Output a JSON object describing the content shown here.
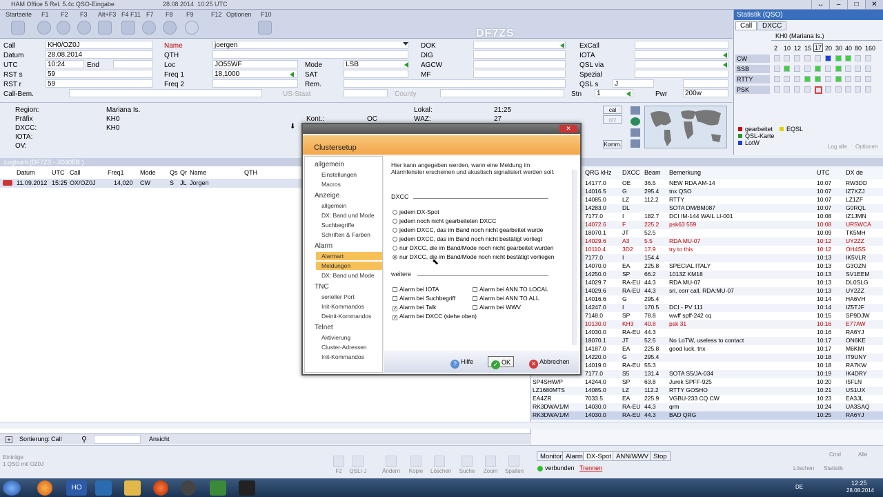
{
  "window": {
    "title_items": [
      "Startseite",
      "F1",
      "F2",
      "F3",
      "Alt+F3",
      "F4 F11",
      "F7",
      "F8",
      "F9",
      "F12",
      "Optionen",
      "F10"
    ],
    "title": "HAM Office 5  Rel. 5.4c   QSO-Eingabe",
    "date": "28.08.2014",
    "time": "10:25 UTC",
    "callsign_display": "DF7ZS"
  },
  "form": {
    "call_label": "Call",
    "call_value": "KH0/OZ0J",
    "date_label": "Datum",
    "date_value": "28.08.2014",
    "utc_label": "UTC",
    "utc_value": "10:24",
    "end_label": "End",
    "rsts_label": "RST s",
    "rsts_value": "59",
    "rstr_label": "RST r",
    "rstr_value": "59",
    "callbem_label": "Call-Bem.",
    "name_label": "Name",
    "name_value": "joergen",
    "qth_label": "QTH",
    "loc_label": "Loc",
    "loc_value": "JO55WF",
    "freq1_label": "Freq 1",
    "freq1_value": "18,1000",
    "freq2_label": "Freq 2",
    "mode_label": "Mode",
    "mode_value": "LSB",
    "sat_label": "SAT",
    "rem_label": "Rem.",
    "usstaat_label": "US-Staat",
    "county_label": "County",
    "dok_label": "DOK",
    "dig_label": "DIG",
    "agcw_label": "AGCW",
    "mf_label": "MF",
    "excall_label": "ExCall",
    "iota_label": "IOTA",
    "qslvia_label": "QSL via",
    "spezial_label": "Spezial",
    "qsls_label": "QSL s",
    "qsls_value": "J",
    "stn_label": "Stn",
    "stn_value": "1",
    "pwr_label": "Pwr",
    "pwr_value": "200w"
  },
  "stats": {
    "header": "Statistik (QSO)",
    "tabs": [
      "Call",
      "DXCC"
    ],
    "entity": "KH0 (Mariana Is.)",
    "bands": [
      "2",
      "10",
      "12",
      "15",
      "17",
      "20",
      "30",
      "40",
      "80",
      "160"
    ],
    "modes": [
      "CW",
      "SSB",
      "RTTY",
      "PSK"
    ],
    "legend": [
      "gearbeitet",
      "EQSL",
      "QSL-Karte",
      "LotW"
    ],
    "actions": [
      "Log alle",
      "Optionen"
    ]
  },
  "info": {
    "region_label": "Region:",
    "region_value": "Mariana Is.",
    "prefix_label": "Präfix",
    "prefix_value": "KH0",
    "dxcc_label": "DXCC:",
    "dxcc_value": "KH0",
    "iota_label": "IOTA:",
    "ov_label": "OV:",
    "kont_label": "Kont.:",
    "kont_value": "OC",
    "lokal_label": "Lokal:",
    "lokal_value": "21:25",
    "waz_label": "WAZ:",
    "waz_value": "27",
    "side_buttons": [
      "cal",
      "qrz",
      "Komm."
    ]
  },
  "logbook": {
    "header": "Logbuch  (DF7ZS - JO40EB )",
    "columns": [
      "Datum",
      "UTC",
      "Call",
      "Freq1",
      "Mode",
      "Qs",
      "Qr",
      "Name",
      "QTH"
    ],
    "row": [
      "11.09.2012",
      "15:25",
      "OX/OZ0J",
      "14,020",
      "CW",
      "S",
      "JL",
      "Jorgen"
    ]
  },
  "dx": {
    "columns": [
      "QRG kHz",
      "DXCC",
      "Beam",
      "Bemerkung",
      "UTC",
      "DX de"
    ],
    "rows": [
      [
        "",
        "14177.0",
        "OE",
        "36.5",
        "NEW RDA AM-14",
        "10:07",
        "RW3DD",
        false
      ],
      [
        "",
        "14016.5",
        "G",
        "295.4",
        "tnx QSO",
        "10:07",
        "IZ7XZJ",
        false
      ],
      [
        "",
        "14085.0",
        "LZ",
        "112.2",
        "RTTY",
        "10:07",
        "LZ1ZF",
        false
      ],
      [
        "",
        "14283.0",
        "DL",
        "",
        "SOTA DM/BM087",
        "10:07",
        "G0RQL",
        false
      ],
      [
        "",
        "7177.0",
        "I",
        "182.7",
        "DCI IM-144 WAIL LI-001",
        "10:08",
        "IZ1JMN",
        false
      ],
      [
        "",
        "14072.6",
        "F",
        "225.2",
        "psk63 559",
        "10:08",
        "UR5WCA",
        true
      ],
      [
        "",
        "18070.1",
        "JT",
        "52.5",
        "",
        "10:09",
        "TK5MH",
        false
      ],
      [
        "",
        "14029.6",
        "A3",
        "5.5",
        "RDA MU-07",
        "10:12",
        "UY2ZZ",
        true
      ],
      [
        "",
        "10110.4",
        "3D2",
        "17.9",
        "try to this",
        "10:12",
        "OH4SS",
        true
      ],
      [
        "",
        "7177.0",
        "I",
        "154.4",
        "",
        "10:13",
        "IK5VLR",
        false
      ],
      [
        "",
        "14070.0",
        "EA",
        "225.8",
        "SPECIAL ITALY",
        "10:13",
        "G3OZN",
        false
      ],
      [
        "",
        "14250.0",
        "SP",
        "66.2",
        "1013Z KM18",
        "10:13",
        "SV1EEM",
        false
      ],
      [
        "",
        "14029.7",
        "RA-EU",
        "44.3",
        "RDA MU-07",
        "10:13",
        "DL0SLG",
        false
      ],
      [
        "",
        "14029.6",
        "RA-EU",
        "44.3",
        "sri, corr call, RDA:MU-07",
        "10:13",
        "UY2ZZ",
        false
      ],
      [
        "",
        "14016.6",
        "G",
        "295.4",
        "",
        "10:14",
        "HA6VH",
        false
      ],
      [
        "",
        "14247.0",
        "I",
        "170.5",
        "DCI - PV 111",
        "10:14",
        "IZ5TJF",
        false
      ],
      [
        "",
        "7148.0",
        "SP",
        "78.8",
        "wwff spff-242 cq",
        "10:15",
        "SP9DJW",
        false
      ],
      [
        "",
        "10130.0",
        "KH3",
        "40.8",
        "psk 31",
        "10:16",
        "E77AW",
        true
      ],
      [
        "",
        "14030.0",
        "RA-EU",
        "44.3",
        "",
        "10:16",
        "RA6YJ",
        false
      ],
      [
        "",
        "18070.1",
        "JT",
        "52.5",
        "No LoTW, useless to contact",
        "10:17",
        "ON6KE",
        false
      ],
      [
        "",
        "14187.0",
        "EA",
        "225.8",
        "good luck. tnx",
        "10:17",
        "M6KMI",
        false
      ],
      [
        "",
        "14220.0",
        "G",
        "295.4",
        "",
        "10:18",
        "IT9UNY",
        false
      ],
      [
        "",
        "14019.0",
        "RA-EU",
        "55.3",
        "",
        "10:18",
        "RA7KW",
        false
      ],
      [
        "",
        "7177.0",
        "S5",
        "131.4",
        "SOTA S5/JA-034",
        "10:19",
        "IK4DRY",
        false
      ],
      [
        "SP4SHW/P",
        "14244.0",
        "SP",
        "63.8",
        "Jurek SPFF-925",
        "10:20",
        "I5FLN",
        false
      ],
      [
        "LZ1680MTS",
        "14085.0",
        "LZ",
        "112.2",
        "RTTY GOSHO",
        "10:21",
        "US1UX",
        false
      ],
      [
        "EA4ZR",
        "7033.5",
        "EA",
        "225.9",
        "VGBU-233 CQ CW",
        "10:23",
        "EA3JL",
        false
      ],
      [
        "RK3DWA/1/M",
        "14030.0",
        "RA-EU",
        "44.3",
        "qrm",
        "10:24",
        "UA3SAQ",
        false
      ],
      [
        "RK3DWA/1/M",
        "14030.0",
        "RA-EU",
        "44.3",
        "BAD QRG",
        "10:25",
        "RA6YJ",
        false
      ]
    ]
  },
  "dialog": {
    "title": "Clustersetup",
    "nav": [
      {
        "group": "allgemein",
        "items": [
          "Einstellungen",
          "Macros"
        ]
      },
      {
        "group": "Anzeige",
        "items": [
          "allgemein",
          "DX: Band und Mode",
          "Suchbegriffe",
          "Schriften & Farben"
        ]
      },
      {
        "group": "Alarm",
        "items": [
          "Alarmart",
          "Meldungen",
          "DX: Band und Mode"
        ]
      },
      {
        "group": "TNC",
        "items": [
          "serieller Port",
          "Init-Kommandos",
          "Deinit-Kommandos"
        ]
      },
      {
        "group": "Telnet",
        "items": [
          "Aktivierung",
          "Cluster-Adressen",
          "Init-Kommandos"
        ]
      }
    ],
    "description": "Hier kann angegeben werden,  wann eine Meldung im Alarmfenster erscheinen und akustisch signalisiert werden soll.",
    "dxcc_section": "DXCC",
    "radios": [
      "jedem DX-Spot",
      "jedem noch nicht gearbeiteten DXCC",
      "jedem DXCC, das im Band noch nicht gearbeitet wurde",
      "jedem DXCC, das im Band noch nicht bestätigt vorliegt",
      "nur DXCC, die im Band/Mode noch nicht gearbeitet wurden",
      "nur DXCC, die im Band/Mode noch nicht bestätigt vorliegen"
    ],
    "weitere_section": "weitere",
    "checks_left": [
      "Alarm bei IOTA",
      "Alarm bei Suchbegriff",
      "Alarm bei Talk",
      "Alarm bei DXCC (siehe oben)"
    ],
    "checks_right": [
      "Alarm bei ANN TO LOCAL",
      "Alarm bei ANN TO ALL",
      "Alarm bei WWV"
    ],
    "help_label": "Hilfe",
    "ok_label": "OK",
    "cancel_label": "Abbrechen"
  },
  "bottom": {
    "sort_label": "Sortierung:",
    "sort_value": "Call",
    "view_label": "Ansicht",
    "entries_label": "Einträge",
    "entries_value": "1 QSO mit OZ0J",
    "tools": [
      "F2",
      "QSLr J",
      "Ändern",
      "Kopie",
      "Löschen",
      "Suche",
      "Zoom",
      "Spalten"
    ],
    "dx_tabs": [
      "Monitor",
      "Alarm",
      "DX-Spot",
      "ANN/WWV",
      "Stop"
    ],
    "connected": "verbunden",
    "disconnect": "Trennen",
    "right_tools": [
      "Löschen",
      "Statistik",
      "Cmd",
      "Alle"
    ]
  },
  "taskbar": {
    "lang": "DE",
    "time": "12:25",
    "date": "28.08.2014",
    "app_label": "HO"
  }
}
